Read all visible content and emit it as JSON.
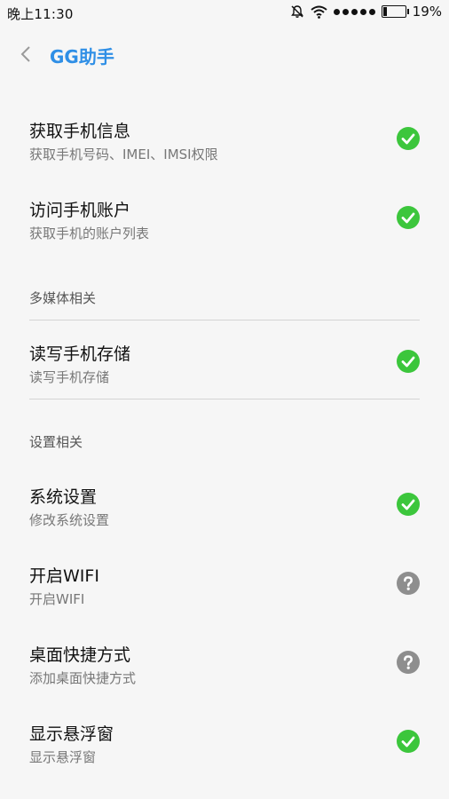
{
  "status_bar": {
    "time": "晚上11:30",
    "battery_text": "19%",
    "battery_level": 0.19,
    "icons": [
      "mute-bell-icon",
      "wifi-icon",
      "signal-dots-icon",
      "battery-icon"
    ]
  },
  "header": {
    "title": "GG助手",
    "back_icon": "chevron-left-icon",
    "accent_color": "#2f8fe6"
  },
  "colors": {
    "granted": "#3cc63c",
    "unknown": "#8e8e8e"
  },
  "permissions": [
    {
      "title": "获取手机信息",
      "subtitle": "获取手机号码、IMEI、IMSI权限",
      "status": "granted",
      "icon": "check-circle-icon"
    },
    {
      "title": "访问手机账户",
      "subtitle": "获取手机的账户列表",
      "status": "granted",
      "icon": "check-circle-icon"
    },
    {
      "title": "读写手机存储",
      "subtitle": "读写手机存储",
      "status": "granted",
      "icon": "check-circle-icon"
    },
    {
      "title": "系统设置",
      "subtitle": "修改系统设置",
      "status": "granted",
      "icon": "check-circle-icon"
    },
    {
      "title": "开启WIFI",
      "subtitle": "开启WIFI",
      "status": "unknown",
      "icon": "question-circle-icon"
    },
    {
      "title": "桌面快捷方式",
      "subtitle": "添加桌面快捷方式",
      "status": "unknown",
      "icon": "question-circle-icon"
    },
    {
      "title": "显示悬浮窗",
      "subtitle": "显示悬浮窗",
      "status": "granted",
      "icon": "check-circle-icon"
    }
  ],
  "sections": {
    "multimedia": "多媒体相关",
    "settings": "设置相关"
  }
}
